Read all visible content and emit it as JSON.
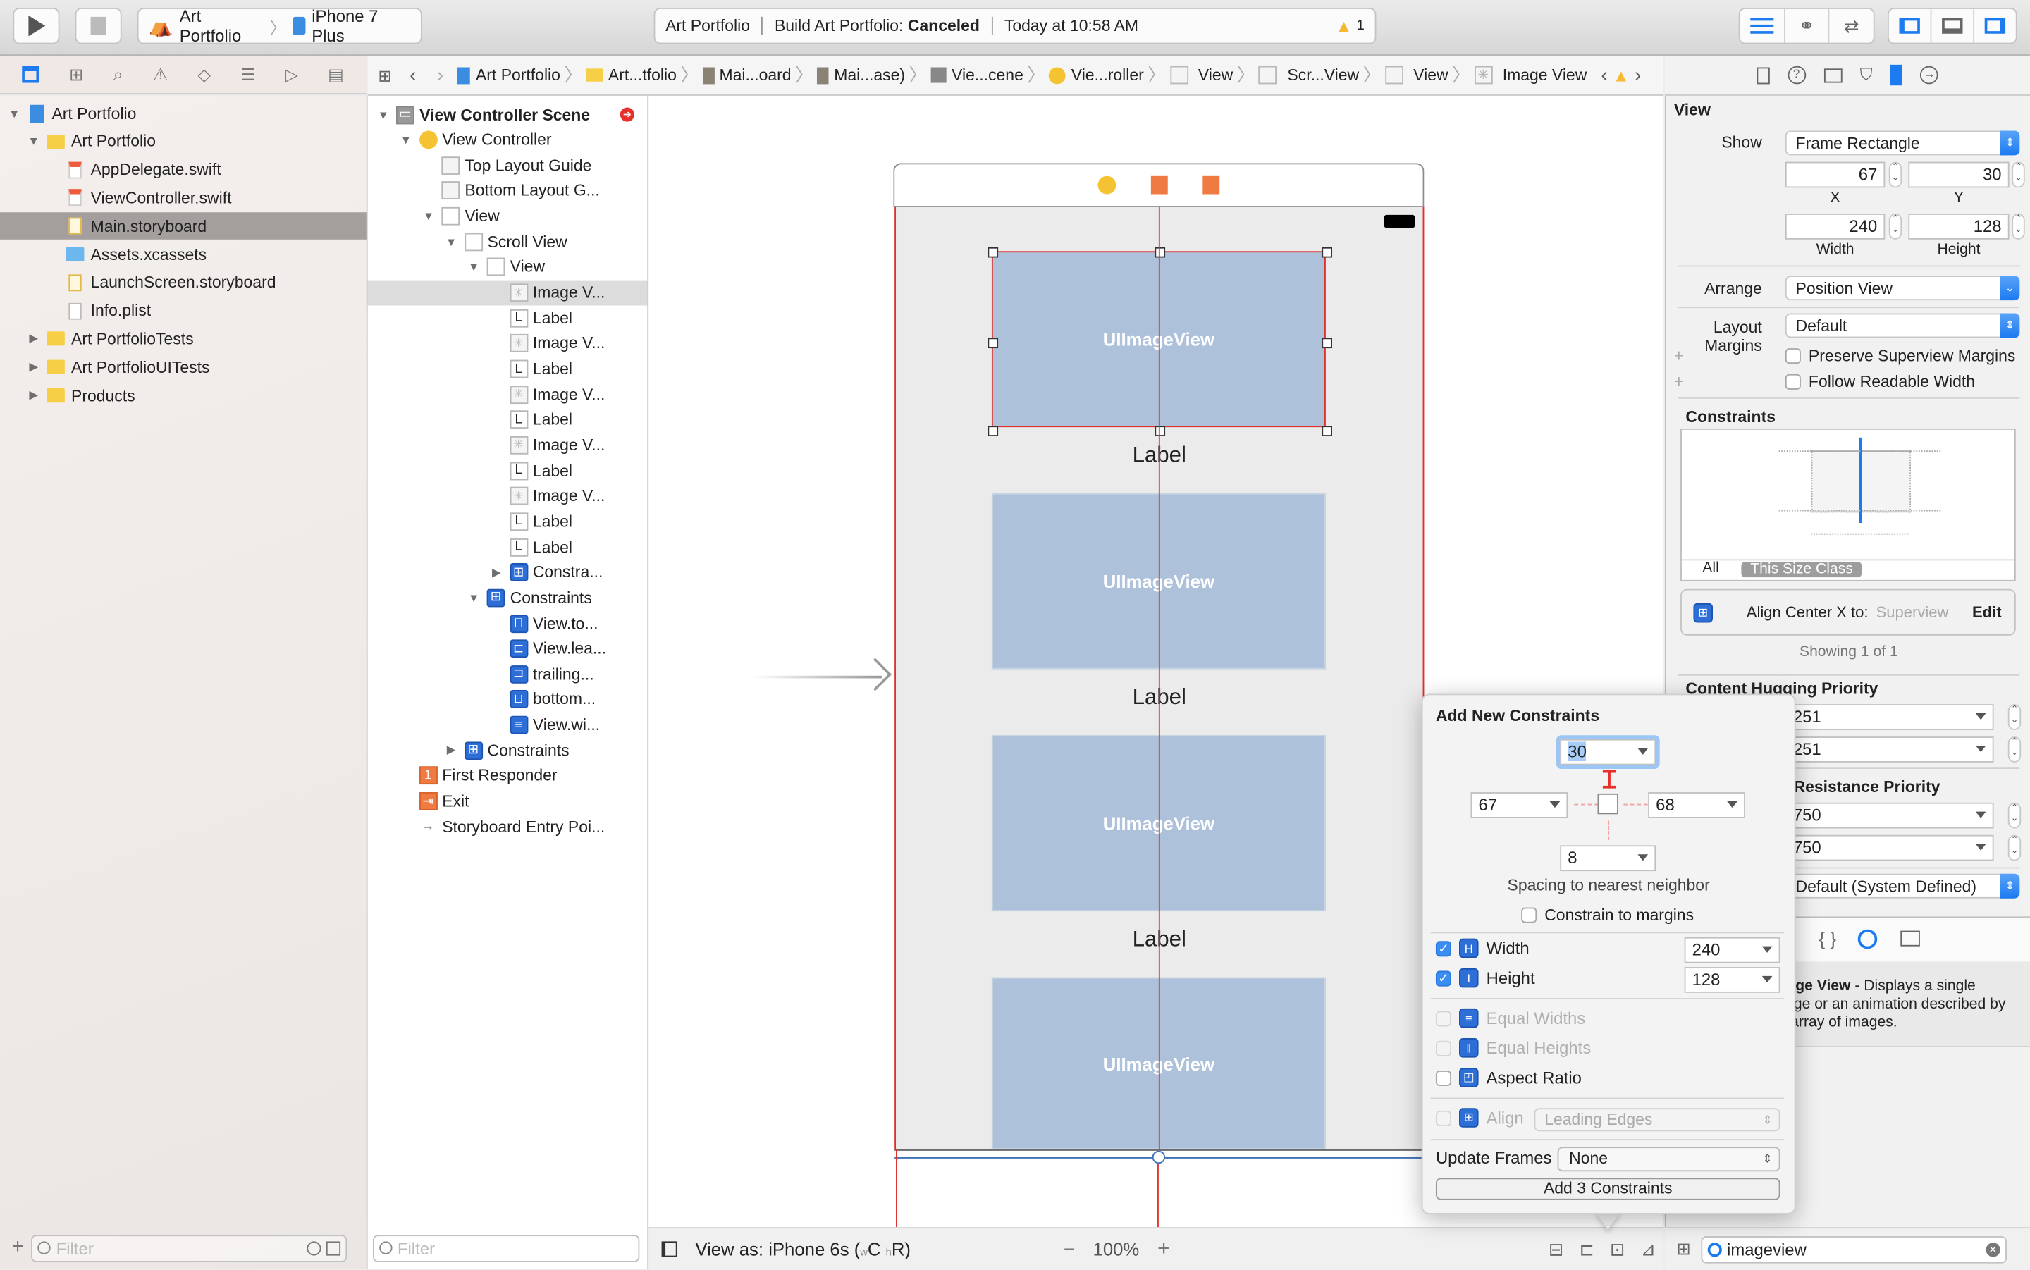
{
  "toolbar": {
    "scheme_target": "Art Portfolio",
    "scheme_device": "iPhone 7 Plus",
    "activity": {
      "project": "Art Portfolio",
      "build_prefix": "Build Art Portfolio:",
      "build_status": "Canceled",
      "time": "Today at 10:58 AM",
      "warning_count": "1"
    },
    "editor_modes": [
      "standard-editor",
      "assistant-editor",
      "version-editor"
    ],
    "view_toggles": [
      "navigator",
      "debug-area",
      "utilities"
    ]
  },
  "navigator": {
    "tabs": [
      "project",
      "symbol",
      "find",
      "issue",
      "test",
      "debug",
      "breakpoint",
      "report"
    ],
    "items": [
      {
        "label": "Art Portfolio",
        "icon": "project-icon",
        "level": 0,
        "disclosure": "open"
      },
      {
        "label": "Art Portfolio",
        "icon": "folder-icon",
        "level": 1,
        "disclosure": "open"
      },
      {
        "label": "AppDelegate.swift",
        "icon": "swift-file-icon",
        "level": 2
      },
      {
        "label": "ViewController.swift",
        "icon": "swift-file-icon",
        "level": 2
      },
      {
        "label": "Main.storyboard",
        "icon": "storyboard-file-icon",
        "level": 2,
        "selected": true
      },
      {
        "label": "Assets.xcassets",
        "icon": "assets-folder-icon",
        "level": 2
      },
      {
        "label": "LaunchScreen.storyboard",
        "icon": "storyboard-file-icon",
        "level": 2
      },
      {
        "label": "Info.plist",
        "icon": "plist-file-icon",
        "level": 2
      },
      {
        "label": "Art PortfolioTests",
        "icon": "folder-icon",
        "level": 1,
        "disclosure": "closed"
      },
      {
        "label": "Art PortfolioUITests",
        "icon": "folder-icon",
        "level": 1,
        "disclosure": "closed"
      },
      {
        "label": "Products",
        "icon": "folder-icon",
        "level": 1,
        "disclosure": "closed"
      }
    ],
    "filter_placeholder": "Filter"
  },
  "jumpbar": {
    "crumbs": [
      "Art Portfolio",
      "Art...tfolio",
      "Mai...oard",
      "Mai...ase)",
      "Vie...cene",
      "Vie...roller",
      "View",
      "Scr...View",
      "View",
      "Image View"
    ]
  },
  "outline": {
    "items": [
      {
        "label": "View Controller Scene",
        "icon": "scene-icon",
        "level": 0,
        "disclosure": "open",
        "bold": true
      },
      {
        "label": "View Controller",
        "icon": "view-controller-icon",
        "level": 1,
        "disclosure": "open"
      },
      {
        "label": "Top Layout Guide",
        "icon": "layout-guide-icon",
        "level": 2
      },
      {
        "label": "Bottom Layout G...",
        "icon": "layout-guide-icon",
        "level": 2
      },
      {
        "label": "View",
        "icon": "view-icon",
        "level": 2,
        "disclosure": "open"
      },
      {
        "label": "Scroll View",
        "icon": "scroll-view-icon",
        "level": 3,
        "disclosure": "open"
      },
      {
        "label": "View",
        "icon": "view-icon",
        "level": 4,
        "disclosure": "open"
      },
      {
        "label": "Image V...",
        "icon": "image-view-icon",
        "level": 5,
        "selected": true
      },
      {
        "label": "Label",
        "icon": "label-icon",
        "level": 5
      },
      {
        "label": "Image V...",
        "icon": "image-view-icon",
        "level": 5
      },
      {
        "label": "Label",
        "icon": "label-icon",
        "level": 5
      },
      {
        "label": "Image V...",
        "icon": "image-view-icon",
        "level": 5
      },
      {
        "label": "Label",
        "icon": "label-icon",
        "level": 5
      },
      {
        "label": "Image V...",
        "icon": "image-view-icon",
        "level": 5
      },
      {
        "label": "Label",
        "icon": "label-icon",
        "level": 5
      },
      {
        "label": "Image V...",
        "icon": "image-view-icon",
        "level": 5
      },
      {
        "label": "Label",
        "icon": "label-icon",
        "level": 5
      },
      {
        "label": "Label",
        "icon": "label-icon",
        "level": 5
      },
      {
        "label": "Constra...",
        "icon": "constraints-icon",
        "level": 5,
        "disclosure": "closed"
      },
      {
        "label": "Constraints",
        "icon": "constraints-icon",
        "level": 4,
        "disclosure": "open"
      },
      {
        "label": "View.to...",
        "icon": "constraint-top-icon",
        "level": 5
      },
      {
        "label": "View.lea...",
        "icon": "constraint-leading-icon",
        "level": 5
      },
      {
        "label": "trailing...",
        "icon": "constraint-trailing-icon",
        "level": 5
      },
      {
        "label": "bottom...",
        "icon": "constraint-bottom-icon",
        "level": 5
      },
      {
        "label": "View.wi...",
        "icon": "constraint-width-icon",
        "level": 5
      },
      {
        "label": "Constraints",
        "icon": "constraints-icon",
        "level": 3,
        "disclosure": "closed"
      },
      {
        "label": "First Responder",
        "icon": "first-responder-icon",
        "level": 1
      },
      {
        "label": "Exit",
        "icon": "exit-icon",
        "level": 1
      },
      {
        "label": "Storyboard Entry Poi...",
        "icon": "entry-arrow-icon",
        "level": 1
      }
    ],
    "filter_placeholder": "Filter"
  },
  "canvas": {
    "image_view_text": "UIImageView",
    "label_text": "Label",
    "view_as": "View as: iPhone 6s (",
    "size_class_w": "w",
    "size_class_c": "C",
    "size_class_h": "h",
    "size_class_r": "R)",
    "zoom_minus": "−",
    "zoom": "100%",
    "zoom_plus": "+"
  },
  "inspector": {
    "section": "View",
    "show_label": "Show",
    "show_value": "Frame Rectangle",
    "x": "67",
    "y": "30",
    "width": "240",
    "height": "128",
    "x_label": "X",
    "y_label": "Y",
    "width_label": "Width",
    "height_label": "Height",
    "arrange_label": "Arrange",
    "arrange_value": "Position View",
    "layout_margins_label": "Layout Margins",
    "layout_margins_value": "Default",
    "preserve_superview_margins": "Preserve Superview Margins",
    "follow_readable_width": "Follow Readable Width",
    "constraints_title": "Constraints",
    "filter_all": "All",
    "filter_size_class": "This Size Class",
    "constraint_item": "Align Center X to:",
    "constraint_target": "Superview",
    "edit": "Edit",
    "showing": "Showing 1 of 1",
    "hugging_title": "Content Hugging Priority",
    "hugging_h": "251",
    "hugging_v": "251",
    "compression_title": "Compression Resistance Priority",
    "compression_h": "750",
    "compression_v": "750",
    "intrinsic_size": "Default (System Defined)",
    "library_desc_bold": "Image View",
    "library_desc": " - Displays a single image or an animation described by an array of images.",
    "library_search": "imageview"
  },
  "popover": {
    "title": "Add New Constraints",
    "top": "30",
    "leading": "67",
    "trailing": "68",
    "bottom": "8",
    "spacing_caption": "Spacing to nearest neighbor",
    "constrain_margins": "Constrain to margins",
    "width_label": "Width",
    "width_value": "240",
    "width_checked": true,
    "height_label": "Height",
    "height_value": "128",
    "height_checked": true,
    "equal_widths": "Equal Widths",
    "equal_heights": "Equal Heights",
    "aspect_ratio": "Aspect Ratio",
    "align_label": "Align",
    "align_value": "Leading Edges",
    "update_frames_label": "Update Frames",
    "update_frames_value": "None",
    "add_button": "Add 3 Constraints"
  },
  "colors": {
    "accent": "#1c7bf0",
    "constraint_red": "#e0302c",
    "image_view_fill": "#adc1da",
    "warning": "#f5b82e"
  }
}
